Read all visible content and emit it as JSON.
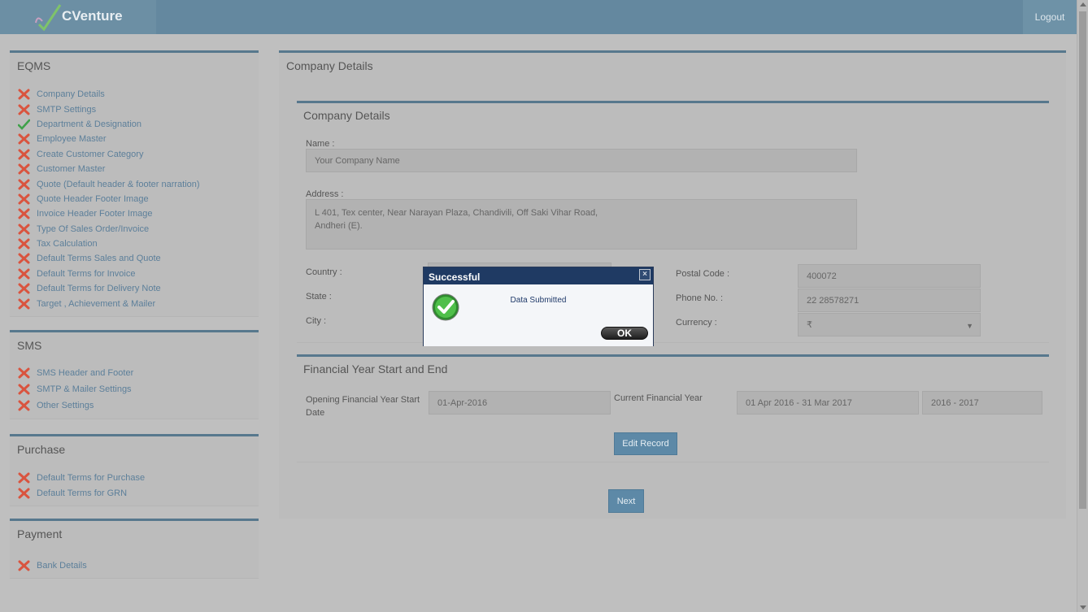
{
  "header": {
    "brand": "CVenture",
    "logout_label": "Logout"
  },
  "sidebar": {
    "sections": [
      {
        "title": "EQMS",
        "items": [
          {
            "label": "Company Details",
            "status": "incomplete"
          },
          {
            "label": "SMTP Settings",
            "status": "incomplete"
          },
          {
            "label": "Department & Designation",
            "status": "complete"
          },
          {
            "label": "Employee Master",
            "status": "incomplete"
          },
          {
            "label": "Create Customer Category",
            "status": "incomplete"
          },
          {
            "label": "Customer Master",
            "status": "incomplete"
          },
          {
            "label": "Quote (Default header & footer narration)",
            "status": "incomplete"
          },
          {
            "label": "Quote Header Footer Image",
            "status": "incomplete"
          },
          {
            "label": "Invoice Header Footer Image",
            "status": "incomplete"
          },
          {
            "label": "Type Of Sales Order/Invoice",
            "status": "incomplete"
          },
          {
            "label": "Tax Calculation",
            "status": "incomplete"
          },
          {
            "label": "Default Terms Sales and Quote",
            "status": "incomplete"
          },
          {
            "label": "Default Terms for Invoice",
            "status": "incomplete"
          },
          {
            "label": "Default Terms for Delivery Note",
            "status": "incomplete"
          },
          {
            "label": "Target , Achievement & Mailer",
            "status": "incomplete"
          }
        ]
      },
      {
        "title": "SMS",
        "items": [
          {
            "label": "SMS Header and Footer",
            "status": "incomplete"
          },
          {
            "label": "SMTP & Mailer Settings",
            "status": "incomplete"
          },
          {
            "label": "Other Settings",
            "status": "incomplete"
          }
        ]
      },
      {
        "title": "Purchase",
        "items": [
          {
            "label": "Default Terms for Purchase",
            "status": "incomplete"
          },
          {
            "label": "Default Terms for GRN",
            "status": "incomplete"
          }
        ]
      },
      {
        "title": "Payment",
        "items": [
          {
            "label": "Bank Details",
            "status": "incomplete"
          }
        ]
      }
    ]
  },
  "main": {
    "title": "Company Details",
    "company": {
      "title": "Company Details",
      "name_label": "Name :",
      "name_value": "Your Company Name",
      "address_label": "Address :",
      "address_value": "L 401, Tex center, Near Narayan Plaza, Chandivili, Off Saki Vihar Road,\n Andheri (E).",
      "country_label": "Country :",
      "state_label": "State :",
      "city_label": "City :",
      "postal_label": "Postal Code :",
      "postal_value": "400072",
      "phone_label": "Phone No. :",
      "phone_value": "22 28578271",
      "currency_label": "Currency :",
      "currency_value": "₹"
    },
    "financial": {
      "title": "Financial Year Start and End",
      "opening_label": "Opening Financial Year Start Date",
      "opening_value": "01-Apr-2016",
      "current_label": "Current Financial Year",
      "current_range": "01 Apr 2016 - 31 Mar 2017",
      "current_year": "2016 - 2017",
      "edit_label": "Edit Record"
    },
    "next_label": "Next"
  },
  "dialog": {
    "title": "Successful",
    "close_symbol": "×",
    "message": "Data Submitted",
    "ok_label": "OK"
  },
  "colors": {
    "header": "#64889f",
    "panel_border": "#57788d",
    "link": "#5c7f9a",
    "incomplete_icon": "#d9543f",
    "complete_icon": "#3fa14a",
    "dialog_title_bg": "#1f3a63"
  }
}
